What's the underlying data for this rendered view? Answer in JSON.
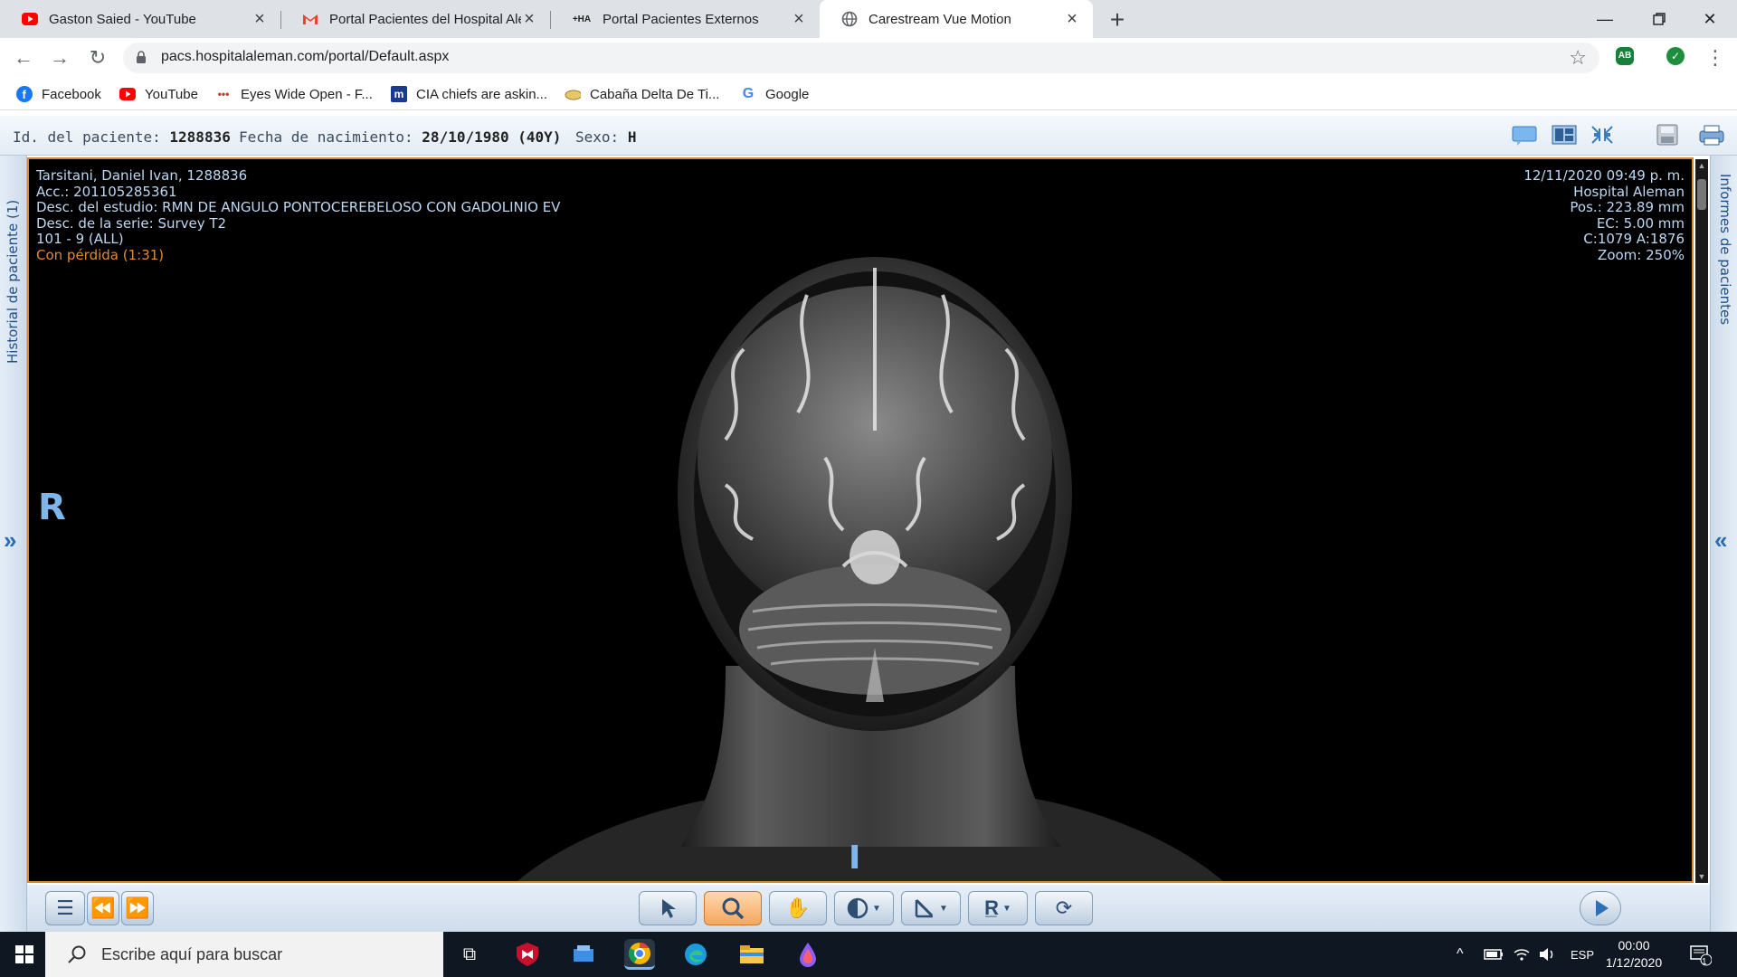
{
  "browser": {
    "tabs": [
      {
        "title": "Gaston Saied - YouTube",
        "icon": "youtube-icon"
      },
      {
        "title": "Portal Pacientes del Hospital Alem",
        "icon": "gmail-icon"
      },
      {
        "title": "Portal Pacientes Externos",
        "icon": "ha-logo-icon"
      },
      {
        "title": "Carestream Vue Motion",
        "icon": "globe-icon",
        "active": true
      }
    ],
    "url": "pacs.hospitalaleman.com/portal/Default.aspx",
    "bookmarks": [
      {
        "label": "Facebook",
        "icon": "facebook-icon"
      },
      {
        "label": "YouTube",
        "icon": "youtube-icon"
      },
      {
        "label": "Eyes Wide Open - F...",
        "icon": "dots-icon"
      },
      {
        "label": "CIA chiefs are askin...",
        "icon": "m-logo-icon"
      },
      {
        "label": "Cabaña Delta De Ti...",
        "icon": "cabin-icon"
      },
      {
        "label": "Google",
        "icon": "google-icon"
      }
    ]
  },
  "patient": {
    "id_label": "Id. del paciente:",
    "id_value": "1288836",
    "dob_label": "Fecha de nacimiento:",
    "dob_value": "28/10/1980 (40Y)",
    "sex_label": "Sexo:",
    "sex_value": "H"
  },
  "side": {
    "left_label": "Historial de paciente (1)",
    "right_label": "Informes de pacientes"
  },
  "overlay": {
    "top_left": [
      "Tarsitani, Daniel Ivan, 1288836",
      "Acc.: 201105285361",
      "Desc. del estudio: RMN DE ANGULO PONTOCEREBELOSO CON GADOLINIO EV",
      "Desc. de la serie: Survey T2",
      "101 - 9 (ALL)"
    ],
    "warning": "Con pérdida (1:31)",
    "top_right": [
      "12/11/2020 09:49 p. m.",
      "Hospital Aleman",
      "Pos.: 223.89 mm",
      "EC: 5.00 mm",
      "C:1079 A:1876",
      "Zoom: 250%"
    ],
    "orient_left": "R",
    "orient_bottom": "I"
  },
  "taskbar": {
    "search_placeholder": "Escribe aquí para buscar",
    "lang": "ESP",
    "time": "00:00",
    "date": "1/12/2020",
    "notif_count": "1"
  },
  "colors": {
    "accent": "#2b6cb0",
    "viewer_border": "#d18a3b",
    "overlay_text": "#bcd8f3",
    "warning_text": "#e58a2a"
  }
}
